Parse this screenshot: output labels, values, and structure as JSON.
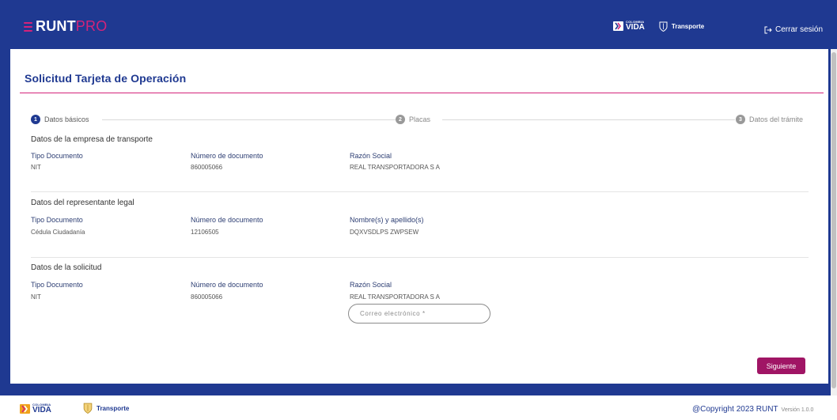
{
  "header": {
    "brand_main": "RUNT",
    "brand_accent": "PRO",
    "gov_logo_small": "COLOMBIA",
    "gov_logo_big": "VIDA",
    "ministry": "Transporte",
    "logout_label": "Cerrar sesión",
    "colors": {
      "primary": "#1f3991",
      "accent": "#d4237a",
      "button": "#a01565"
    }
  },
  "page": {
    "title": "Solicitud Tarjeta de Operación"
  },
  "stepper": {
    "steps": [
      {
        "number": "1",
        "label": "Datos básicos",
        "state": "active"
      },
      {
        "number": "2",
        "label": "Placas",
        "state": "inactive"
      },
      {
        "number": "3",
        "label": "Datos del trámite",
        "state": "inactive"
      }
    ]
  },
  "company": {
    "title": "Datos de la empresa de transporte",
    "doc_type_label": "Tipo Documento",
    "doc_type_value": "NIT",
    "doc_number_label": "Número de documento",
    "doc_number_value": "860005066",
    "name_label": "Razón Social",
    "name_value": "REAL TRANSPORTADORA S A"
  },
  "representative": {
    "title": "Datos del representante legal",
    "doc_type_label": "Tipo Documento",
    "doc_type_value": "Cédula Ciudadanía",
    "doc_number_label": "Número de documento",
    "doc_number_value": "12106505",
    "name_label": "Nombre(s) y apellido(s)",
    "name_value": "DQXVSDLPS ZWPSEW"
  },
  "request": {
    "title": "Datos de la solicitud",
    "doc_type_label": "Tipo Documento",
    "doc_type_value": "NIT",
    "doc_number_label": "Número de documento",
    "doc_number_value": "860005066",
    "name_label": "Razón Social",
    "name_value": "REAL TRANSPORTADORA S A",
    "email_placeholder": "Correo electrónico *",
    "email_value": ""
  },
  "actions": {
    "next_label": "Siguiente"
  },
  "footer": {
    "gov_logo_small": "COLOMBIA",
    "gov_logo_big": "VIDA",
    "ministry": "Transporte",
    "copyright": "@Copyright 2023 RUNT",
    "version": "Versión 1.0.0"
  }
}
